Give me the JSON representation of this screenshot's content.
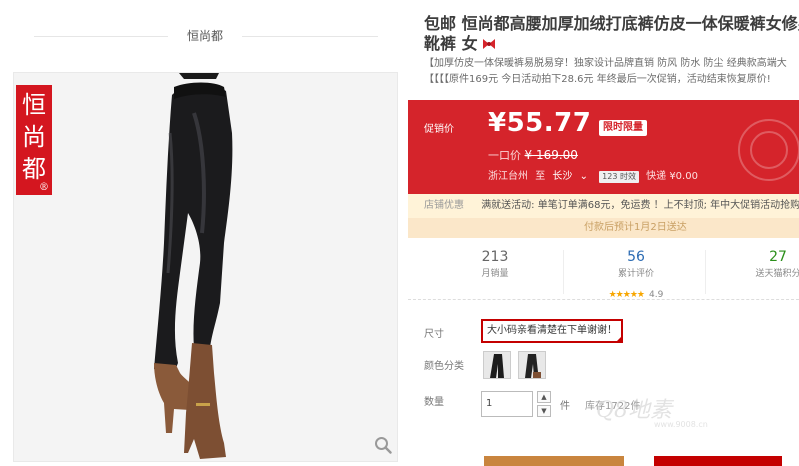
{
  "store": {
    "name": "恒尚都"
  },
  "gallery": {
    "logo_chars": [
      "恒",
      "尚",
      "都"
    ],
    "logo_reg": "®"
  },
  "product": {
    "title_line1": "包邮 恒尚都高腰加厚加绒打底裤仿皮一体保暖裤女修身",
    "title_line2": "靴裤 女",
    "subtitle1": "【加厚仿皮一体保暖裤易脱易穿！独家设计品牌直销 防风 防水 防尘 经典款高端大",
    "subtitle2": "【【【【原件169元 今日活动拍下28.6元 年终最后一次促销，活动结束恢复原价!"
  },
  "price": {
    "label": "促销价",
    "value": "¥55.77",
    "limit_tag": "限时限量",
    "original_label": "一口价",
    "original_value": "¥ 169.00",
    "ship_from": "浙江台州",
    "ship_to_label": "至",
    "ship_to": "长沙",
    "timing_tag": "123 时效",
    "express": "快递 ¥0.00"
  },
  "promo": {
    "label": "店铺优惠",
    "text": "满就送活动: 单笔订单满68元，免运费 ！上不封顶; 年中大促销活动抢购",
    "notice": "付款后预计1月2日送达"
  },
  "stats": [
    {
      "num": "213",
      "label": "月销量"
    },
    {
      "num": "56",
      "label": "累计评价",
      "stars": "★★★★★",
      "rating": "4.9"
    },
    {
      "num": "27",
      "label": "送天猫积分"
    }
  ],
  "options": {
    "size_label": "尺寸",
    "size_value": "大小码亲看清楚在下单谢谢！",
    "color_label": "颜色分类",
    "qty_label": "数量",
    "qty_value": "1",
    "qty_unit": "件",
    "stock": "库存1722件"
  },
  "watermark": {
    "main": "Q8地素",
    "sub": "www.9008.cn"
  },
  "colors": {
    "accent": "#d5242b",
    "promo_bg": "#fff3d8",
    "buy": "#c9853e",
    "cart": "#c40000"
  }
}
